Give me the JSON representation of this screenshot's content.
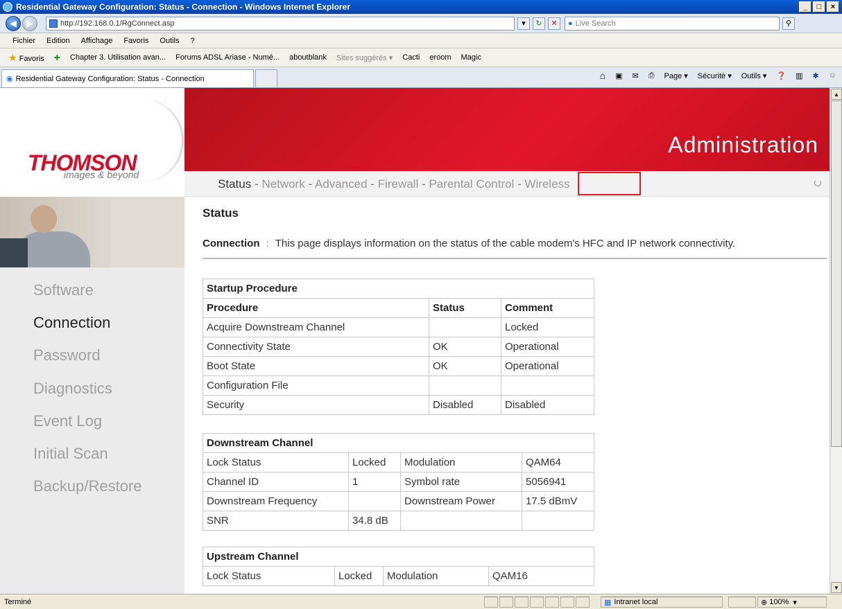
{
  "window": {
    "title": "Residential Gateway Configuration: Status - Connection - Windows Internet Explorer"
  },
  "browser": {
    "url": "http://192.168.0.1/RgConnect.asp",
    "search_placeholder": "Live Search",
    "menu": [
      "Fichier",
      "Edition",
      "Affichage",
      "Favoris",
      "Outils",
      "?"
    ],
    "favorites_label": "Favoris",
    "favorites": [
      "Chapter 3. Utilisation avan...",
      "Forums ADSL Ariase - Numé...",
      "aboutblank",
      "Sites suggérés ▾",
      "Cacti",
      "eroom",
      "Magic"
    ],
    "tab_title": "Residential Gateway Configuration: Status - Connection",
    "commands": [
      "Page ▾",
      "Sécurité ▾",
      "Outils ▾"
    ],
    "status_text": "Terminé",
    "zone": "Intranet local",
    "zoom": "100%"
  },
  "brand": {
    "logo": "THOMSON",
    "tagline": "images & beyond",
    "header_title": "Administration"
  },
  "nav": {
    "items": [
      "Status",
      "Network",
      "Advanced",
      "Firewall",
      "Parental Control",
      "Wireless"
    ],
    "separator": "-"
  },
  "sidebar": {
    "items": [
      "Software",
      "Connection",
      "Password",
      "Diagnostics",
      "Event Log",
      "Initial Scan",
      "Backup/Restore"
    ],
    "active": "Connection"
  },
  "page": {
    "title": "Status",
    "desc_label": "Connection",
    "desc_sep": ":",
    "desc_text": "This page displays information on the status of the cable modem's HFC and IP network connectivity."
  },
  "startup": {
    "title": "Startup Procedure",
    "headers": [
      "Procedure",
      "Status",
      "Comment"
    ],
    "rows": [
      [
        "Acquire Downstream Channel",
        "",
        "Locked"
      ],
      [
        "Connectivity State",
        "OK",
        "Operational"
      ],
      [
        "Boot State",
        "OK",
        "Operational"
      ],
      [
        "Configuration File",
        "",
        ""
      ],
      [
        "Security",
        "Disabled",
        "Disabled"
      ]
    ]
  },
  "downstream": {
    "title": "Downstream Channel",
    "rows": [
      [
        "Lock Status",
        "Locked",
        "Modulation",
        "QAM64"
      ],
      [
        "Channel ID",
        "1",
        "Symbol rate",
        "5056941"
      ],
      [
        "Downstream Frequency",
        "",
        "Downstream Power",
        "17.5 dBmV"
      ],
      [
        "SNR",
        "34.8 dB",
        "",
        ""
      ]
    ]
  },
  "upstream": {
    "title": "Upstream Channel",
    "rows": [
      [
        "Lock Status",
        "Locked",
        "Modulation",
        "QAM16"
      ]
    ]
  }
}
